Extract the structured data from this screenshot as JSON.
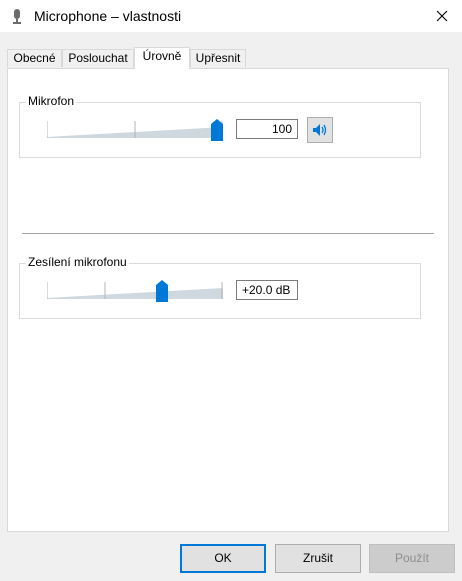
{
  "window": {
    "title": "Microphone – vlastnosti",
    "icon": "microphone-icon",
    "close_icon": "close-icon"
  },
  "tabs": [
    {
      "label": "Obecné",
      "active": false
    },
    {
      "label": "Poslouchat",
      "active": false
    },
    {
      "label": "Úrovně",
      "active": true
    },
    {
      "label": "Upřesnit",
      "active": false
    }
  ],
  "levels": {
    "microphone": {
      "label": "Mikrofon",
      "value": 100,
      "value_text": "100",
      "min": 0,
      "max": 100,
      "mute_icon": "speaker-icon"
    },
    "boost": {
      "label": "Zesílení mikrofonu",
      "value_db": 20.0,
      "value_text": "+20.0 dB",
      "min_db": 0,
      "max_db": 30
    }
  },
  "buttons": {
    "ok": "OK",
    "cancel": "Zrušit",
    "apply": "Použít",
    "apply_enabled": false
  },
  "colors": {
    "accent": "#0078d7",
    "thumb": "#0078d7",
    "ramp": "#cfd8de"
  }
}
